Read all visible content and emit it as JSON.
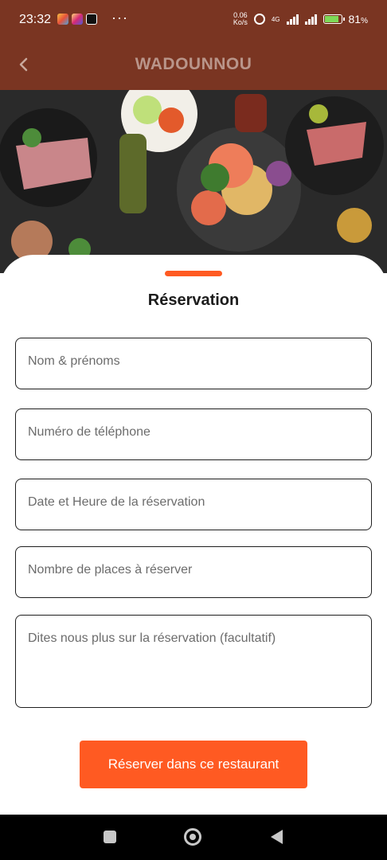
{
  "status": {
    "time": "23:32",
    "net_speed_value": "0.06",
    "net_speed_unit": "Ko/s",
    "network_type": "4G",
    "battery_percent_label": "81",
    "battery_percent_suffix": "%",
    "battery_level": 0.81,
    "more_label": "···"
  },
  "app_bar": {
    "back_icon": "chevron-left-icon",
    "title": "WADOUNNOU"
  },
  "hero": {
    "image": "food-spread-image"
  },
  "form": {
    "title": "Réservation",
    "fields": [
      {
        "placeholder": "Nom & prénoms"
      },
      {
        "placeholder": "Numéro de téléphone"
      },
      {
        "placeholder": "Date et Heure de la réservation"
      },
      {
        "placeholder": "Nombre de places à réserver"
      },
      {
        "placeholder": "Dites nous plus sur la réservation (facultatif)"
      }
    ],
    "submit_label": "Réserver dans ce restaurant"
  },
  "colors": {
    "app_bar": "#7a3522",
    "accent": "#ff5a22",
    "border": "#1f1f1f"
  }
}
